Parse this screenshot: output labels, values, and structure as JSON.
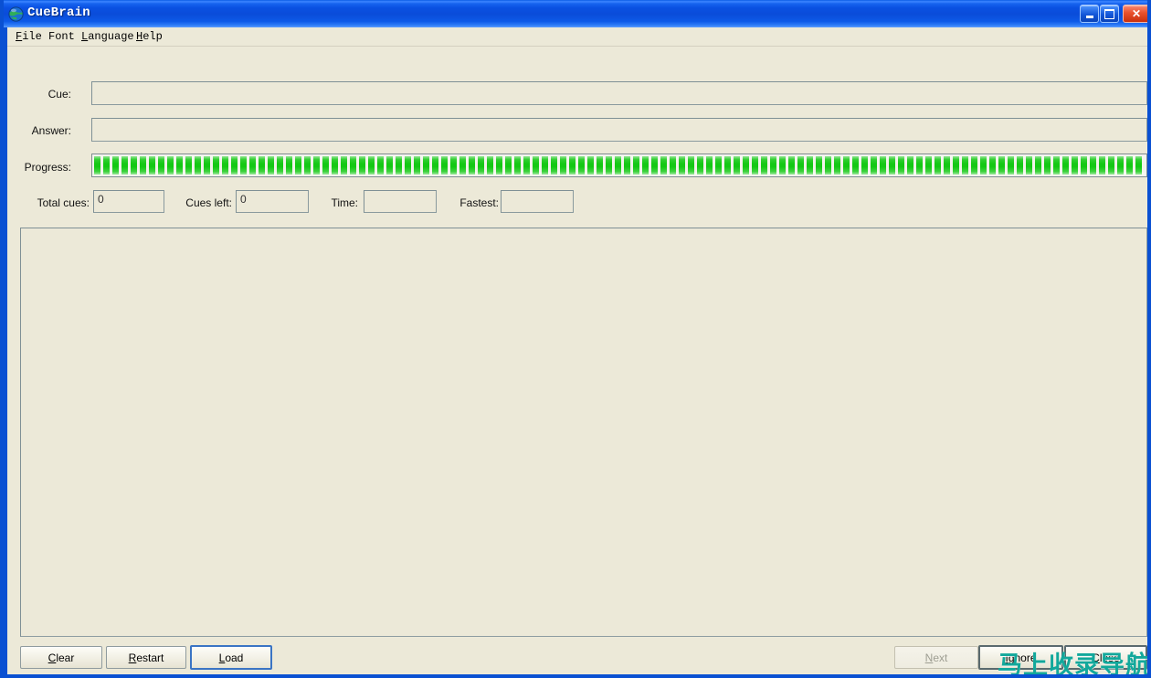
{
  "window": {
    "title": "CueBrain",
    "icon": "globe-icon",
    "accent_titlebar": "#0a4cd9",
    "background": "#ece9d8",
    "controls": {
      "minimize": "minimize-icon",
      "maximize": "maximize-icon",
      "close": "close-icon"
    }
  },
  "menubar": {
    "items": [
      {
        "label": "File",
        "mnemonic": "F"
      },
      {
        "label": "Font",
        "mnemonic": "F"
      },
      {
        "label": "Language",
        "mnemonic": "L"
      },
      {
        "label": "Help",
        "mnemonic": "H"
      }
    ]
  },
  "form": {
    "cue": {
      "label": "Cue:",
      "value": "",
      "placeholder": ""
    },
    "answer": {
      "label": "Answer:",
      "value": "",
      "placeholder": ""
    },
    "progress": {
      "label": "Progress:",
      "percent": 100,
      "bar_color": "#14c814",
      "style": "segmented"
    },
    "counters": [
      {
        "label": "Total cues:",
        "value": "0"
      },
      {
        "label": "Cues left:",
        "value": "0"
      },
      {
        "label": "Time:",
        "value": ""
      },
      {
        "label": "Fastest:",
        "value": ""
      }
    ]
  },
  "main_panel": {
    "content": ""
  },
  "buttons": {
    "left": [
      {
        "label": "Clear",
        "mnemonic": "C",
        "state": "enabled"
      },
      {
        "label": "Restart",
        "mnemonic": "R",
        "state": "enabled"
      },
      {
        "label": "Load",
        "mnemonic": "L",
        "state": "focused"
      }
    ],
    "right": [
      {
        "label": "Next",
        "mnemonic": "N",
        "state": "disabled"
      },
      {
        "label": "Ignore",
        "mnemonic": "I",
        "state": "enabled"
      },
      {
        "label": "Close",
        "mnemonic": "C",
        "state": "enabled"
      }
    ]
  },
  "watermark": {
    "text": "马上收录导航",
    "color": "#12a89b"
  }
}
